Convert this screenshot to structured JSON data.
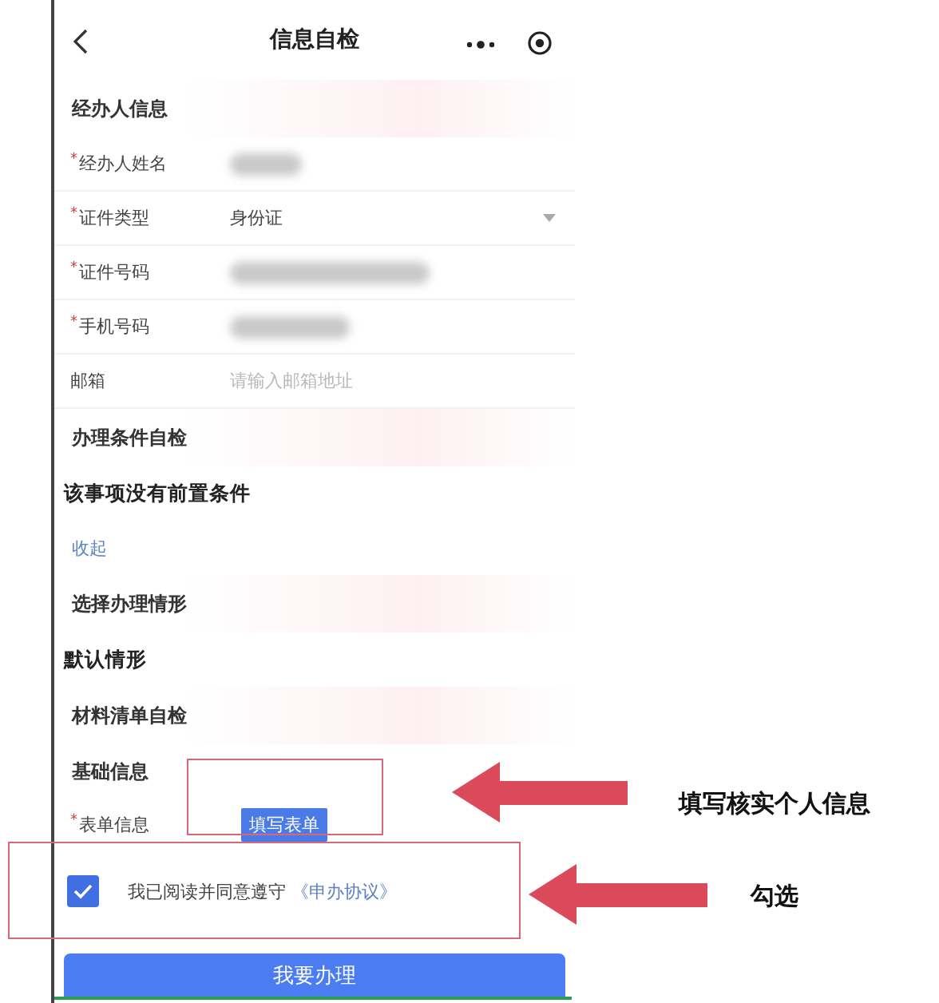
{
  "header": {
    "title": "信息自检"
  },
  "rows": [
    {
      "kind": "heading",
      "text": "经办人信息"
    },
    {
      "kind": "blurred",
      "mark": "*",
      "label": "经办人姓名"
    },
    {
      "kind": "select",
      "mark": "*",
      "label": "证件类型",
      "value": "身份证"
    },
    {
      "kind": "blurred",
      "mark": "*",
      "label": "证件号码"
    },
    {
      "kind": "blurred",
      "mark": "*",
      "label": "手机号码"
    },
    {
      "kind": "input",
      "label": "邮箱",
      "placeholder": "请输入邮箱地址"
    },
    {
      "kind": "heading",
      "text": "办理条件自检"
    },
    {
      "kind": "note",
      "text": "该事项没有前置条件"
    },
    {
      "kind": "link",
      "text": "收起"
    },
    {
      "kind": "heading",
      "text": "选择办理情形"
    },
    {
      "kind": "note",
      "text": "默认情形"
    },
    {
      "kind": "heading",
      "text": "材料清单自检"
    },
    {
      "kind": "subheading",
      "text": "基础信息"
    },
    {
      "kind": "button",
      "mark": "*",
      "label": "表单信息",
      "button": "填写表单"
    }
  ],
  "agreement": {
    "checked": true,
    "text": "我已阅读并同意遵守",
    "link": "《申办协议》"
  },
  "submit": "我要办理",
  "annotations": [
    {
      "text": "填写核实个人信息"
    },
    {
      "text": "勾选"
    }
  ]
}
